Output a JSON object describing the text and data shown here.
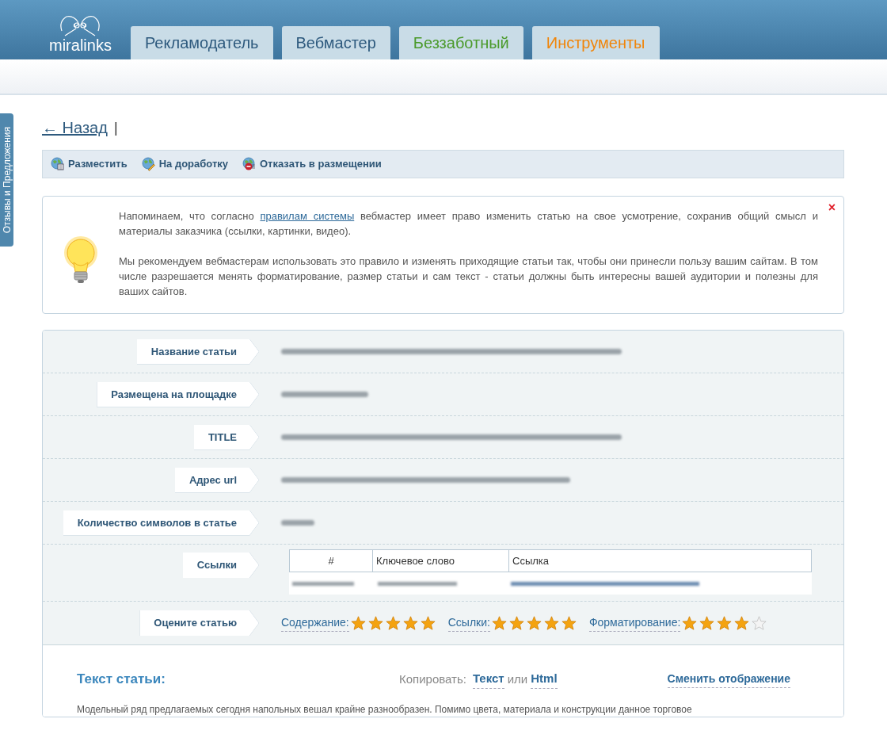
{
  "logo": {
    "text": "miralinks"
  },
  "tabs": [
    {
      "label": "Рекламодатель",
      "color": "#2e5a7e"
    },
    {
      "label": "Вебмастер",
      "color": "#2e5a7e"
    },
    {
      "label": "Беззаботный",
      "color": "#4a9a2a"
    },
    {
      "label": "Инструменты",
      "color": "#f0850a"
    }
  ],
  "sidebar_tab": {
    "label": "Отзывы и Предложения"
  },
  "back_link": {
    "label": "← Назад",
    "separator": "|"
  },
  "toolbar": [
    {
      "label": "Разместить",
      "kind": "publish"
    },
    {
      "label": "На доработку",
      "kind": "revise"
    },
    {
      "label": "Отказать в размещении",
      "kind": "reject"
    }
  ],
  "notice": {
    "before_link": "Напоминаем, что согласно ",
    "link": "правилам системы",
    "after_link": " вебмастер имеет право изменить статью на свое усмотрение, сохранив общий смысл и материалы заказчика (ссылки, картинки, видео).",
    "paragraph_2": "Мы рекомендуем вебмастерам использовать это правило и изменять приходящие статьи так, чтобы они принесли пользу вашим сайтам. В том числе разрешается менять форматирование, размер статьи и сам текст - статьи должны быть интересны вашей аудитории и полезны для ваших сайтов.",
    "close": "×"
  },
  "fields": [
    {
      "label": "Название статьи",
      "kind": "redacted"
    },
    {
      "label": "Размещена на площадке",
      "kind": "redacted"
    },
    {
      "label": "TITLE",
      "kind": "redacted"
    },
    {
      "label": "Адрес url",
      "kind": "redacted"
    },
    {
      "label": "Количество символов в статье",
      "kind": "redacted"
    },
    {
      "label": "Ссылки",
      "kind": "links",
      "columns": [
        "#",
        "Ключевое слово",
        "Ссылка"
      ]
    },
    {
      "label": "Оцените статью",
      "kind": "rating",
      "ratings": [
        {
          "label": "Содержание:",
          "stars": 5
        },
        {
          "label": "Ссылки:",
          "stars": 5
        },
        {
          "label": "Форматирование:",
          "stars": 4
        }
      ]
    }
  ],
  "article": {
    "title": "Текст статьи:",
    "copy_label": "Копировать:",
    "copy_text": "Текст",
    "or": "или",
    "copy_html": "Html",
    "switch_view": "Сменить отображение",
    "body": "Модельный ряд предлагаемых сегодня напольных вешал крайне разнообразен. Помимо цвета, материала и конструкции данное торговое"
  }
}
